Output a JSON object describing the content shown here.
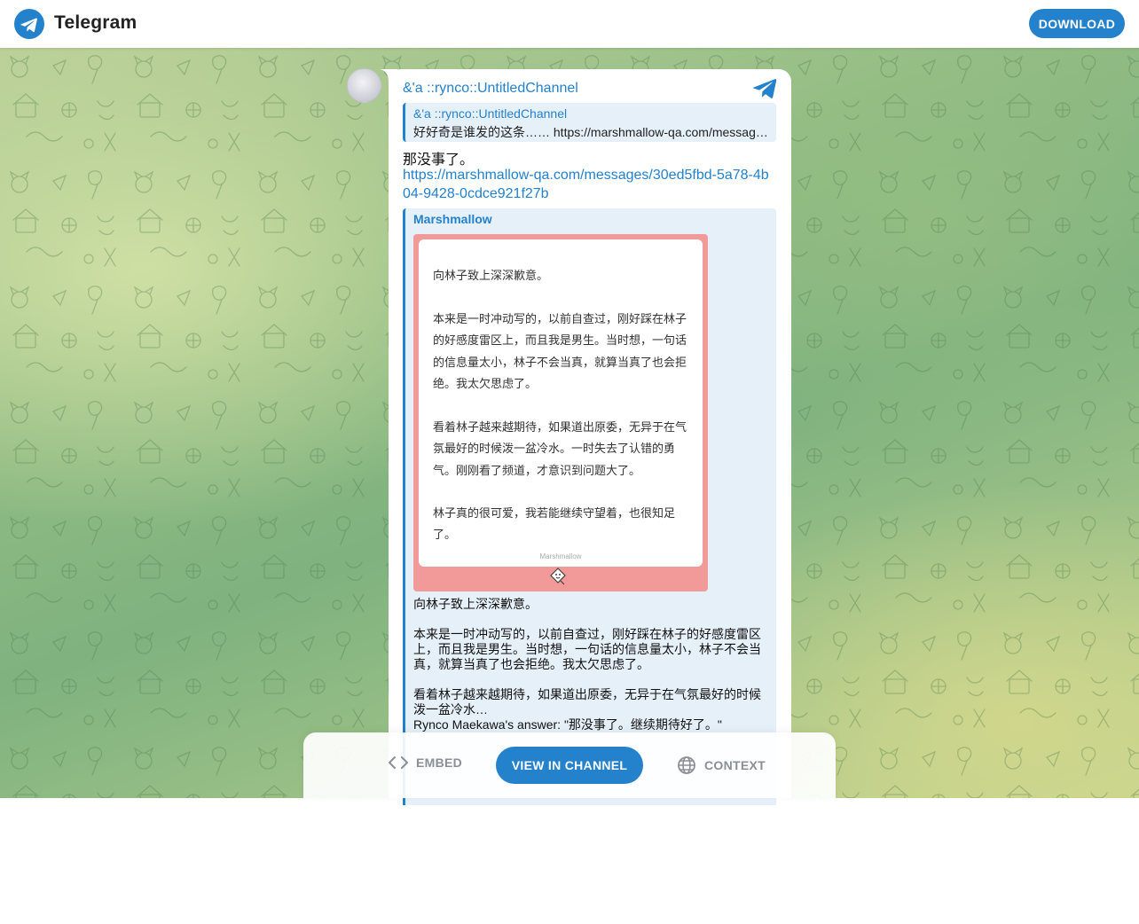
{
  "header": {
    "brand": "Telegram",
    "download_label": "DOWNLOAD",
    "brand_color": "#2481cc"
  },
  "post": {
    "channel_name": "&'a ::rynco::UntitledChannel",
    "reply": {
      "author": "&'a ::rynco::UntitledChannel",
      "text": "好好奇是谁发的这条…… https://marshmallow-qa.com/message…"
    },
    "text": "那没事了。",
    "link": "https://marshmallow-qa.com/messages/30ed5fbd-5a78-4b04-9428-0cdce921f27b",
    "preview": {
      "site_name": "Marshmallow",
      "card_paragraphs": [
        "向林子致上深深歉意。",
        "本来是一时冲动写的，以前自查过，刚好踩在林子的好感度雷区上，而且我是男生。当时想，一句话的信息量太小，林子不会当真，就算当真了也会拒绝。我太欠思虑了。",
        "看着林子越来越期待，如果道出原委，无异于在气氛最好的时候泼一盆冷水。一时失去了认错的勇气。刚刚看了频道，才意识到问题大了。",
        "林子真的很可爱，我若能继续守望着，也很知足了。"
      ],
      "card_watermark": "Marshmallow",
      "description": [
        "向林子致上深深歉意。",
        "本来是一时冲动写的，以前自查过，刚好踩在林子的好感度雷区上，而且我是男生。当时想，一句话的信息量太小，林子不会当真，就算当真了也会拒绝。我太欠思虑了。",
        "看着林子越来越期待，如果道出原委，无异于在气氛最好的时候泼一盆冷水…",
        "Rynco Maekawa's answer: \"那没事了。继续期待好了。\""
      ]
    }
  },
  "actions": {
    "embed_label": "EMBED",
    "view_label": "VIEW IN CHANNEL",
    "context_label": "CONTEXT"
  }
}
